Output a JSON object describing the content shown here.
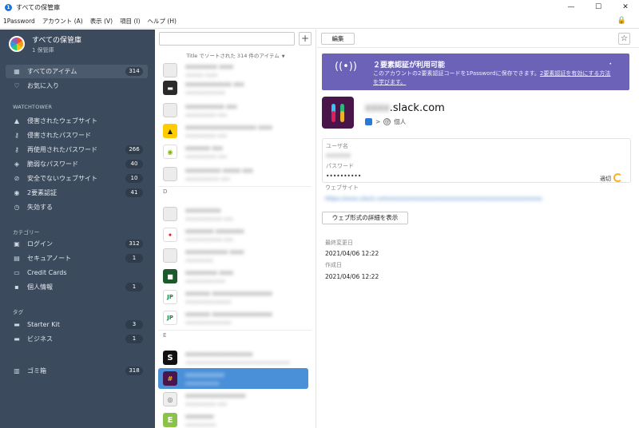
{
  "window": {
    "title": "すべての保管庫",
    "app_icon_glyph": "1",
    "controls": {
      "minimize": "—",
      "maximize": "☐",
      "close": "✕"
    }
  },
  "menu": [
    "1Password",
    "アカウント (A)",
    "表示 (V)",
    "項目 (I)",
    "ヘルプ (H)"
  ],
  "sidebar": {
    "vault_name": "すべての保管庫",
    "vault_sub": "1 保管庫",
    "main_items": [
      {
        "label": "すべてのアイテム",
        "count": "314",
        "icon": "grid-icon"
      },
      {
        "label": "お気に入り",
        "count": "",
        "icon": "heart-icon"
      }
    ],
    "watchtower_label": "WATCHTOWER",
    "watchtower_items": [
      {
        "label": "侵害されたウェブサイト",
        "count": "",
        "icon": "warning-icon"
      },
      {
        "label": "侵害されたパスワード",
        "count": "",
        "icon": "key-icon"
      },
      {
        "label": "再使用されたパスワード",
        "count": "266",
        "icon": "key-icon"
      },
      {
        "label": "脆弱なパスワード",
        "count": "40",
        "icon": "shield-icon"
      },
      {
        "label": "安全でないウェブサイト",
        "count": "10",
        "icon": "unlock-icon"
      },
      {
        "label": "2要素認証",
        "count": "41",
        "icon": "broadcast-icon"
      },
      {
        "label": "失効する",
        "count": "",
        "icon": "clock-icon"
      }
    ],
    "category_label": "カテゴリー",
    "category_items": [
      {
        "label": "ログイン",
        "count": "312",
        "icon": "login-icon"
      },
      {
        "label": "セキュアノート",
        "count": "1",
        "icon": "note-icon"
      },
      {
        "label": "Credit Cards",
        "count": "",
        "icon": "card-icon"
      },
      {
        "label": "個人情報",
        "count": "1",
        "icon": "id-icon"
      }
    ],
    "tag_label": "タグ",
    "tag_items": [
      {
        "label": "Starter Kit",
        "count": "3",
        "icon": "tag-icon"
      },
      {
        "label": "ビジネス",
        "count": "1",
        "icon": "tag-icon"
      }
    ],
    "trash": {
      "label": "ゴミ箱",
      "count": "318",
      "icon": "trash-icon"
    }
  },
  "list": {
    "search_placeholder": "",
    "add_label": "+",
    "sort_text": "Title でソートされた 314 件のアイテム",
    "sort_caret": "▼",
    "section_d": "D",
    "section_e": "E",
    "items": [
      {
        "title": "xxxxxxxxx xxxx",
        "sub": "xxxxxx xxxx",
        "icon": "key",
        "glyph": ""
      },
      {
        "title": "xxxxxxxxxxxxx xxx",
        "sub": "xxxxxxxxxxxxx",
        "icon": "dark",
        "glyph": "▬"
      },
      {
        "title": "xxxxxxxxxxx xxx",
        "sub": "xxxxxxxxxx xxx",
        "icon": "key",
        "glyph": ""
      },
      {
        "title": "xxxxxxxxxxxxxxxxxxxx xxxx",
        "sub": "xxxxxxxxxx xxx",
        "icon": "yellow",
        "glyph": "▲"
      },
      {
        "title": "xxxxxxx xxx",
        "sub": "xxxxxxxxxx xxx",
        "icon": "green",
        "glyph": "◉"
      },
      {
        "title": "xxxxxxxxxx xxxxx xxx",
        "sub": "xxxxxxxxxxx xxx",
        "icon": "key",
        "glyph": ""
      },
      {
        "title": "xxxxxxxxxx",
        "sub": "xxxxxxxxxxxx xxx",
        "icon": "key",
        "glyph": ""
      },
      {
        "title": "xxxxxxxx xxxxxxxx",
        "sub": "xxxxxxxxxxxx xxx",
        "icon": "red",
        "glyph": "✦"
      },
      {
        "title": "xxxxxxxxxxxx xxxx",
        "sub": "xxxxxxxxx",
        "icon": "key",
        "glyph": ""
      },
      {
        "title": "xxxxxxxxx xxxx",
        "sub": "xxxxxxxxxxxxx",
        "icon": "darkgreen",
        "glyph": "■"
      },
      {
        "title": "xxxxxxx xxxxxxxxxxxxxxxxx",
        "sub": "xxxxxxxxxxxxxxx",
        "icon": "jp",
        "glyph": "JP"
      },
      {
        "title": "xxxxxxx xxxxxxxxxxxxxxxxx",
        "sub": "xxxxxxxxxxxxxxx",
        "icon": "jp",
        "glyph": "JP"
      },
      {
        "title": "xxxxxxxxxxxxxxxxxxx",
        "sub": "xxxxxxxxxxxxxxxxxxxxxxxxxxxxxxxxxx",
        "icon": "black",
        "glyph": "S"
      },
      {
        "title": "xxxxxxxxxxx",
        "sub": "xxxxxxxxxxx",
        "icon": "slack",
        "glyph": "#"
      },
      {
        "title": "xxxxxxxxxxxxxxxxx",
        "sub": "xxxxxxxxxx xxx",
        "icon": "gray",
        "glyph": "◎"
      },
      {
        "title": "xxxxxxxx",
        "sub": "xxxxxxxxxx",
        "icon": "lime",
        "glyph": "E"
      }
    ]
  },
  "detail": {
    "edit_label": "編集",
    "star_glyph": "☆",
    "banner": {
      "title": "２要素認証が利用可能",
      "body": "このアカウントの2要素認証コードを1Passwordに保存できます。",
      "link": "2要素認証を有効にする方法を学びます。",
      "icon": "broadcast-icon",
      "dot": "•"
    },
    "item_title_blurred": "xxxx",
    "item_title": ".slack.com",
    "crumb_sep": ">",
    "crumb_circle": "@",
    "crumb_vault": "個人",
    "username_label": "ユーザ名",
    "username_value": "xxxxxxx",
    "password_label": "パスワード",
    "password_value": "••••••••••",
    "strength_label": "適切",
    "website_label": "ウェブサイト",
    "website_value": "https://xxxx.slack.com/xxxxxxxxxxxxxxxxxxxxxxxxxxxxxxxxxxxxxxxxxxxxxx",
    "web_form_button": "ウェブ形式の詳細を表示",
    "modified_label": "最終変更日",
    "modified_value": "2021/04/06 12:22",
    "created_label": "作成日",
    "created_value": "2021/04/06 12:22"
  },
  "colors": {
    "sidebar_bg": "#3b4a5c",
    "selection": "#4a90d9",
    "banner": "#6c63b8",
    "slack_bg": "#4a154b"
  }
}
